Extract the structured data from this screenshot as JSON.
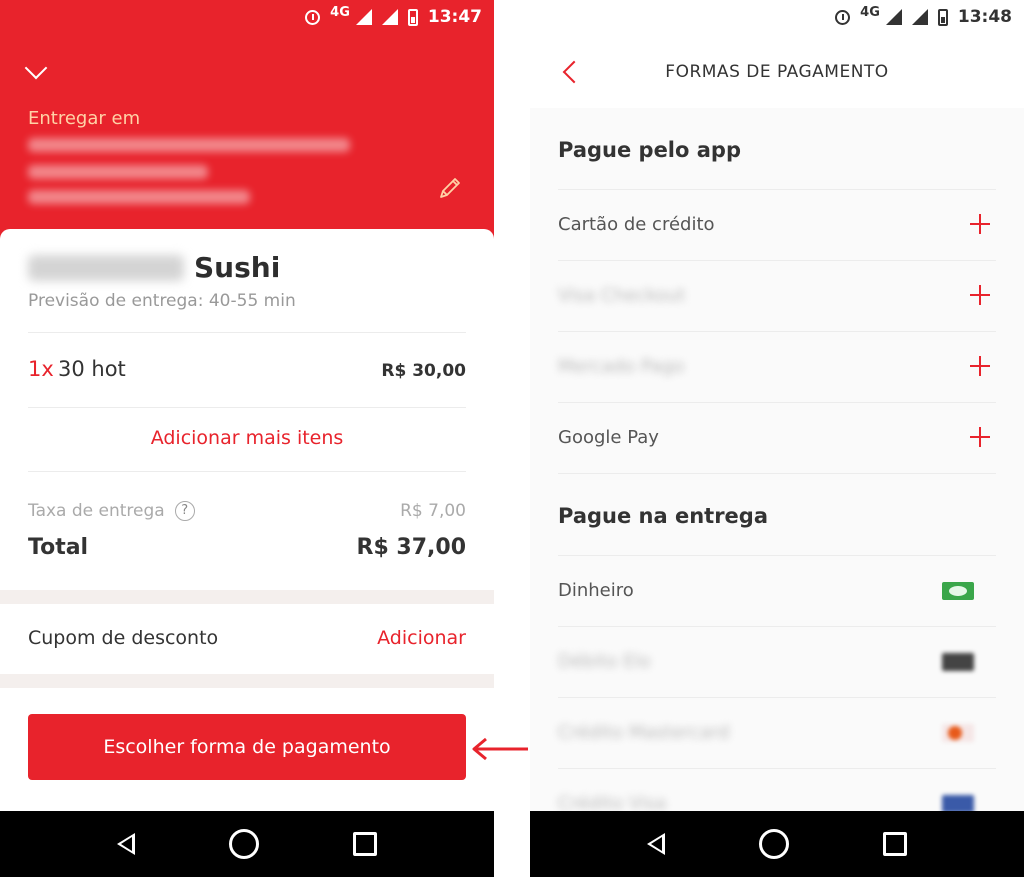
{
  "left": {
    "status": {
      "network": "4G",
      "time": "13:47"
    },
    "header": {
      "deliver_label": "Entregar em"
    },
    "store": {
      "name_suffix": "Sushi",
      "eta": "Previsão de entrega: 40-55 min"
    },
    "item": {
      "qty": "1x",
      "name": "30 hot",
      "price": "R$ 30,00"
    },
    "add_items": "Adicionar mais itens",
    "fee": {
      "label": "Taxa de entrega",
      "help": "?",
      "value": "R$ 7,00"
    },
    "total": {
      "label": "Total",
      "value": "R$ 37,00"
    },
    "coupon": {
      "label": "Cupom de desconto",
      "action": "Adicionar"
    },
    "pay_button": "Escolher forma de pagamento"
  },
  "right": {
    "status": {
      "network": "4G",
      "time": "13:48"
    },
    "title": "FORMAS DE PAGAMENTO",
    "app_section": {
      "title": "Pague pelo app",
      "items": [
        {
          "label": "Cartão de crédito",
          "blurred": false
        },
        {
          "label": "Visa Checkout",
          "blurred": true
        },
        {
          "label": "Mercado Pago",
          "blurred": true
        },
        {
          "label": "Google Pay",
          "blurred": false
        }
      ]
    },
    "delivery_section": {
      "title": "Pague na entrega",
      "items": [
        {
          "label": "Dinheiro",
          "icon": "cash-icon",
          "blurred": false
        },
        {
          "label": "Débito Elo",
          "icon": "card-icon",
          "blurred": true
        },
        {
          "label": "Crédito Mastercard",
          "icon": "mastercard-icon",
          "blurred": true
        },
        {
          "label": "Crédito Visa",
          "icon": "visa-icon",
          "blurred": true
        }
      ]
    }
  },
  "colors": {
    "brand_red": "#e8232c",
    "cash_green": "#3aa64a"
  }
}
